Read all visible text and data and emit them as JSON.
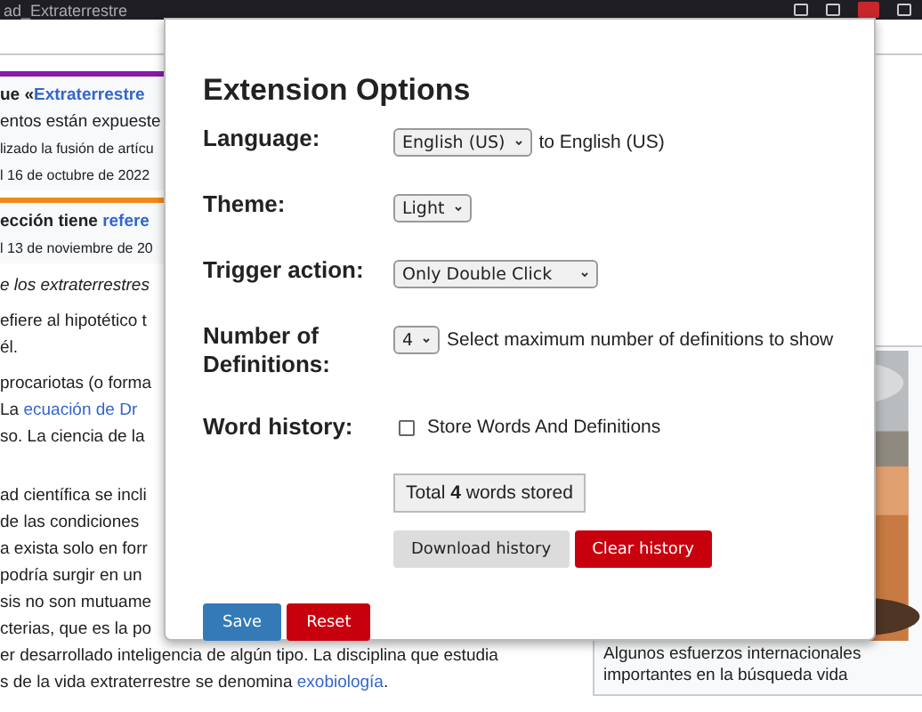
{
  "browser_bar": {
    "tab_title": "ad_Extraterrestre"
  },
  "article": {
    "notices": [
      {
        "color": "#8a1aa8",
        "lines": [
          {
            "kind": "heading",
            "parts": [
              {
                "text": "ue «",
                "link": false
              },
              {
                "text": "Extraterrestre",
                "link": true
              }
            ]
          },
          {
            "kind": "text",
            "parts": [
              {
                "text": "entos están expueste",
                "link": false
              }
            ]
          },
          {
            "kind": "meta",
            "parts": [
              {
                "text": "lizado la fusión de artícu",
                "link": false
              }
            ]
          },
          {
            "kind": "meta",
            "parts": [
              {
                "text": "l 16 de octubre de 2022",
                "link": false
              }
            ]
          }
        ]
      },
      {
        "color": "#f28a1a",
        "lines": [
          {
            "kind": "heading",
            "parts": [
              {
                "text": "ección tiene ",
                "link": false
              },
              {
                "text": "refere",
                "link": true
              }
            ]
          },
          {
            "kind": "meta",
            "parts": [
              {
                "text": "l 13 de noviembre de 20",
                "link": false
              }
            ]
          }
        ]
      }
    ],
    "paragraphs": [
      [
        {
          "kind": "italic",
          "parts": [
            {
              "text": "e los extraterrestres",
              "link": false
            }
          ]
        }
      ],
      [
        {
          "kind": "text",
          "parts": [
            {
              "text": "efiere al hipotético t",
              "link": false
            }
          ]
        },
        {
          "kind": "text",
          "parts": [
            {
              "text": "él.",
              "link": false
            }
          ]
        }
      ],
      [
        {
          "kind": "text",
          "parts": [
            {
              "text": "procariotas (o forma",
              "link": false
            }
          ]
        },
        {
          "kind": "text",
          "parts": [
            {
              "text": "La ",
              "link": false
            },
            {
              "text": "ecuación de Dr",
              "link": true
            }
          ]
        },
        {
          "kind": "text",
          "parts": [
            {
              "text": "so. La ciencia de la",
              "link": false
            }
          ]
        }
      ],
      [
        {
          "kind": "text",
          "parts": [
            {
              "text": "ad científica se incli",
              "link": false
            }
          ]
        },
        {
          "kind": "text",
          "parts": [
            {
              "text": "de las condiciones",
              "link": false
            }
          ]
        },
        {
          "kind": "text",
          "parts": [
            {
              "text": "a exista solo en forr",
              "link": false
            }
          ]
        },
        {
          "kind": "text",
          "parts": [
            {
              "text": "podría surgir en un",
              "link": false
            }
          ]
        },
        {
          "kind": "text",
          "parts": [
            {
              "text": "sis no son mutuame",
              "link": false
            }
          ]
        },
        {
          "kind": "text",
          "parts": [
            {
              "text": "cterias, que es la po",
              "link": false
            }
          ]
        },
        {
          "kind": "text",
          "parts": [
            {
              "text": "er desarrollado inteligencia de algún tipo. La disciplina que estudia",
              "link": false
            }
          ]
        },
        {
          "kind": "text",
          "parts": [
            {
              "text": "s de la vida extraterrestre se denomina ",
              "link": false
            },
            {
              "text": "exobiología",
              "link": true
            },
            {
              "text": ".",
              "link": false
            }
          ]
        }
      ]
    ],
    "figure": {
      "kind": "picture",
      "caption": [
        "Algunos esfuerzos internacionales",
        "importantes en la búsqueda vida"
      ]
    }
  },
  "options": {
    "title": "Extension Options",
    "rows": [
      {
        "kind": "select",
        "label": "Language:",
        "value": "English (US)",
        "note": "to English (US)"
      },
      {
        "kind": "select",
        "label": "Theme:",
        "value": "Light"
      },
      {
        "kind": "select",
        "label": "Trigger action:",
        "value": "Only Double Click",
        "wide": true
      },
      {
        "kind": "select",
        "label": "Number of Definitions:",
        "value": "4",
        "note": "Select maximum number of definitions to show"
      },
      {
        "kind": "checkbox",
        "label": "Word history:",
        "option": "Store Words And Definitions",
        "checked": false
      }
    ],
    "total": "Total **4** words stored",
    "history_buttons": [
      {
        "label": "Download history",
        "kind": "neutral"
      },
      {
        "label": "Clear history",
        "kind": "danger"
      }
    ],
    "footer_buttons": [
      {
        "label": "Save",
        "kind": "primary"
      },
      {
        "label": "Reset",
        "kind": "danger"
      }
    ]
  }
}
